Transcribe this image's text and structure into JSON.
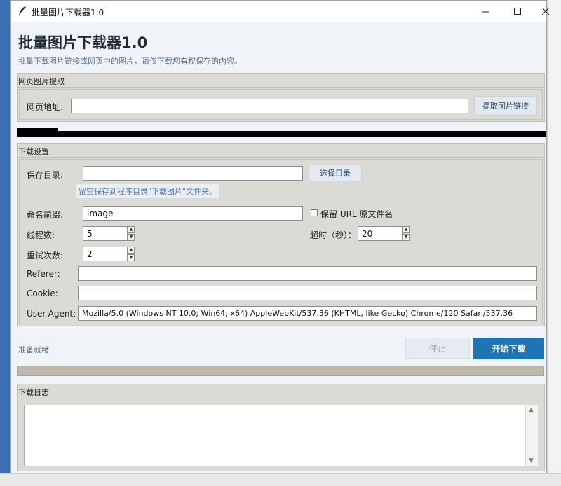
{
  "window": {
    "title": "批量图片下载器1.0"
  },
  "header": {
    "title": "批量图片下载器1.0",
    "subtitle": "批量下载图片链接或网页中的图片，请仅下载您有权保存的内容。"
  },
  "extract": {
    "group_title": "网页图片提取",
    "url_label": "网页地址:",
    "url_value": "",
    "extract_button": "提取图片链接"
  },
  "settings": {
    "group_title": "下载设置",
    "save_dir_label": "保存目录:",
    "save_dir_value": "",
    "choose_dir_button": "选择目录",
    "save_dir_hint": "留空保存到程序目录\"下载图片\"文件夹。",
    "prefix_label": "命名前缀:",
    "prefix_value": "image",
    "keep_name_label": "保留 URL 原文件名",
    "keep_name_checked": false,
    "threads_label": "线程数:",
    "threads_value": "5",
    "timeout_label": "超时（秒）：",
    "timeout_value": "20",
    "retries_label": "重试次数:",
    "retries_value": "2",
    "referer_label": "Referer:",
    "referer_value": "",
    "cookie_label": "Cookie:",
    "cookie_value": "",
    "ua_label": "User-Agent:",
    "ua_value": "Mozilla/5.0 (Windows NT 10.0; Win64; x64) AppleWebKit/537.36 (KHTML, like Gecko) Chrome/120 Safari/537.36"
  },
  "actions": {
    "status": "准备就绪",
    "stop_button": "停止",
    "start_button": "开始下载",
    "progress": 0
  },
  "log": {
    "group_title": "下载日志",
    "content": ""
  },
  "colors": {
    "accent": "#1f74b5",
    "panel": "#dcdad5",
    "background": "#f0f4f8"
  }
}
